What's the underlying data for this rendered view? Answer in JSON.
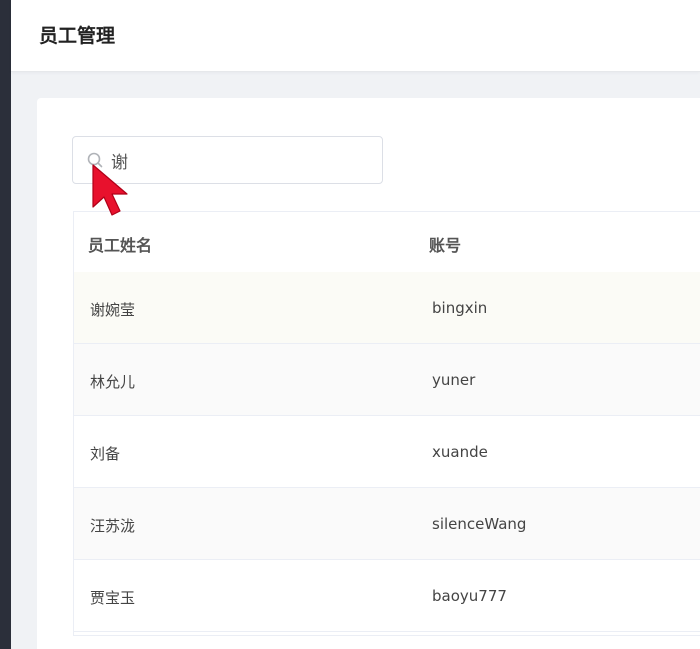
{
  "header": {
    "title": "员工管理"
  },
  "search": {
    "value": "谢",
    "icon": "search-icon"
  },
  "table": {
    "columns": [
      "员工姓名",
      "账号"
    ],
    "rows": [
      {
        "name": "谢婉莹",
        "account": "bingxin"
      },
      {
        "name": "林允儿",
        "account": "yuner"
      },
      {
        "name": "刘备",
        "account": "xuande"
      },
      {
        "name": "汪苏泷",
        "account": "silenceWang"
      },
      {
        "name": "贾宝玉",
        "account": "baoyu777"
      }
    ]
  },
  "colors": {
    "sidebar": "#2b2f3a",
    "background": "#f0f2f5",
    "cursor": "#e8112d"
  }
}
